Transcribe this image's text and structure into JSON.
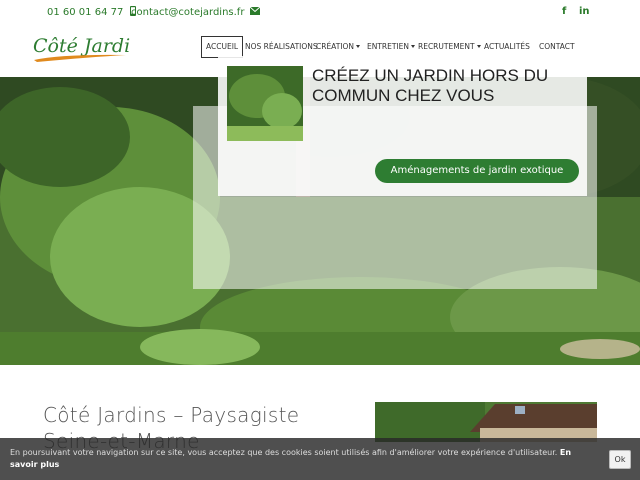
{
  "topbar": {
    "phone": "01 60 01 64 77",
    "email": "contact@cotejardins.fr",
    "social": [
      "f",
      "in"
    ]
  },
  "logo": {
    "text": "Côté Jardins"
  },
  "nav": {
    "items": [
      {
        "label": "ACCUEIL",
        "active": true,
        "dropdown": false
      },
      {
        "label": "NOS RÉALISATIONS",
        "active": false,
        "dropdown": false
      },
      {
        "label": "CRÉATION",
        "active": false,
        "dropdown": true
      },
      {
        "label": "ENTRETIEN",
        "active": false,
        "dropdown": true
      },
      {
        "label": "RECRUTEMENT",
        "active": false,
        "dropdown": true
      },
      {
        "label": "ACTUALITÉS",
        "active": false,
        "dropdown": false
      },
      {
        "label": "CONTACT",
        "active": false,
        "dropdown": false
      }
    ]
  },
  "hero": {
    "title": "CRÉEZ UN JARDIN HORS DU COMMUN CHEZ VOUS",
    "button": "Aménagements de jardin exotique"
  },
  "intro": {
    "title": "Côté Jardins – Paysagiste Seine-et-Marne"
  },
  "cookie": {
    "text": "En poursuivant votre navigation sur ce site, vous acceptez que des cookies soient utilisés afin d'améliorer votre expérience d'utilisateur.",
    "link": "En savoir plus",
    "ok": "Ok"
  },
  "colors": {
    "brand_green": "#2e7d32",
    "logo_orange": "#e08a1e"
  }
}
